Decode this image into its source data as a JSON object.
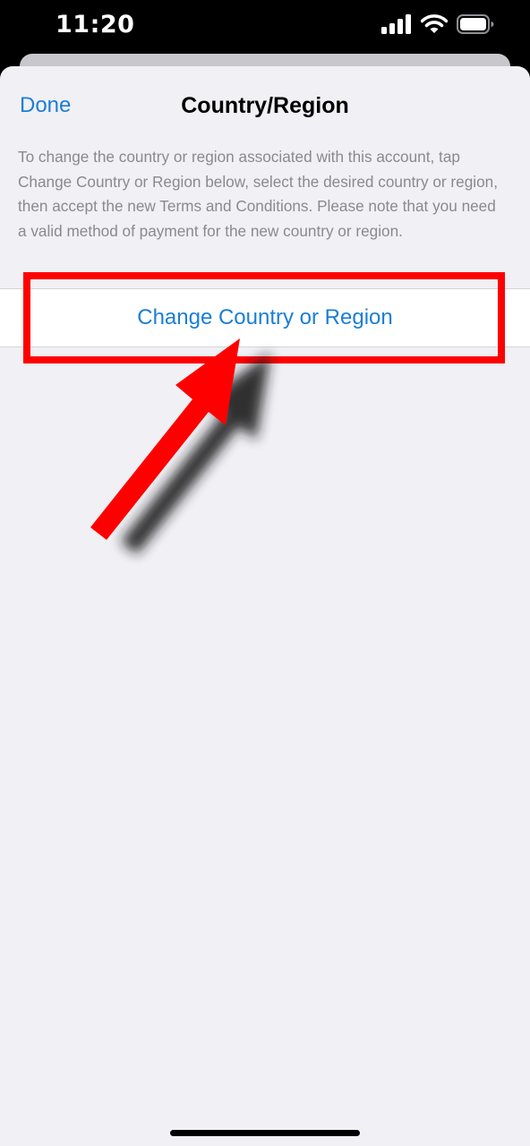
{
  "status_bar": {
    "time": "11:20",
    "icons": [
      "signal-icon",
      "wifi-icon",
      "battery-icon"
    ]
  },
  "nav": {
    "done_label": "Done",
    "title": "Country/Region"
  },
  "description": "To change the country or region associated with this account, tap Change Country or Region below, select the desired country or region, then accept the new Terms and Conditions. Please note that you need a valid method of payment for the new country or region.",
  "action": {
    "label": "Change Country or Region"
  },
  "annotation": {
    "highlight": "red-box",
    "pointer": "red-arrow-icon"
  },
  "colors": {
    "accent": "#1a7ed6",
    "background": "#f0f0f5",
    "annotation": "#ff0000",
    "secondary_text": "#8a8a8e"
  }
}
